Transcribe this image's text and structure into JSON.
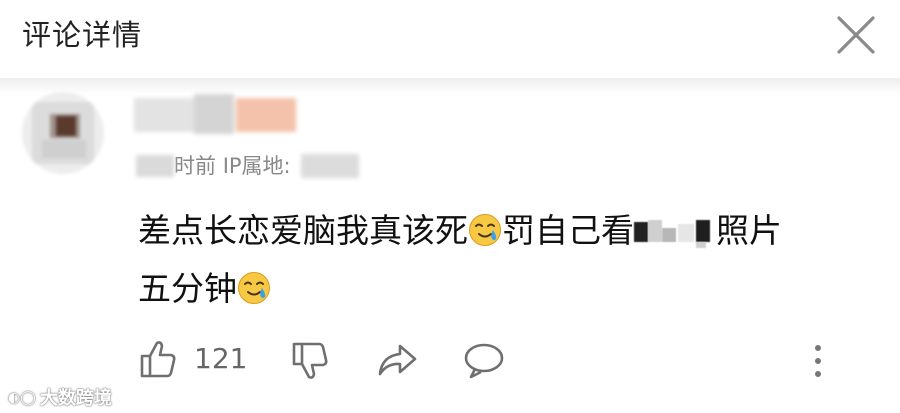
{
  "header": {
    "title": "评论详情"
  },
  "comment": {
    "meta_time": "时前",
    "meta_ip_label": "IP属地:",
    "text_part1": "差点长恋爱脑我真该死",
    "text_part2": "罚自己看",
    "text_part3": "照片",
    "text_part4": "五分钟",
    "emoji": "crying-smile-icon"
  },
  "actions": {
    "like_count": "121"
  },
  "watermark": {
    "text": "大数跨境"
  }
}
